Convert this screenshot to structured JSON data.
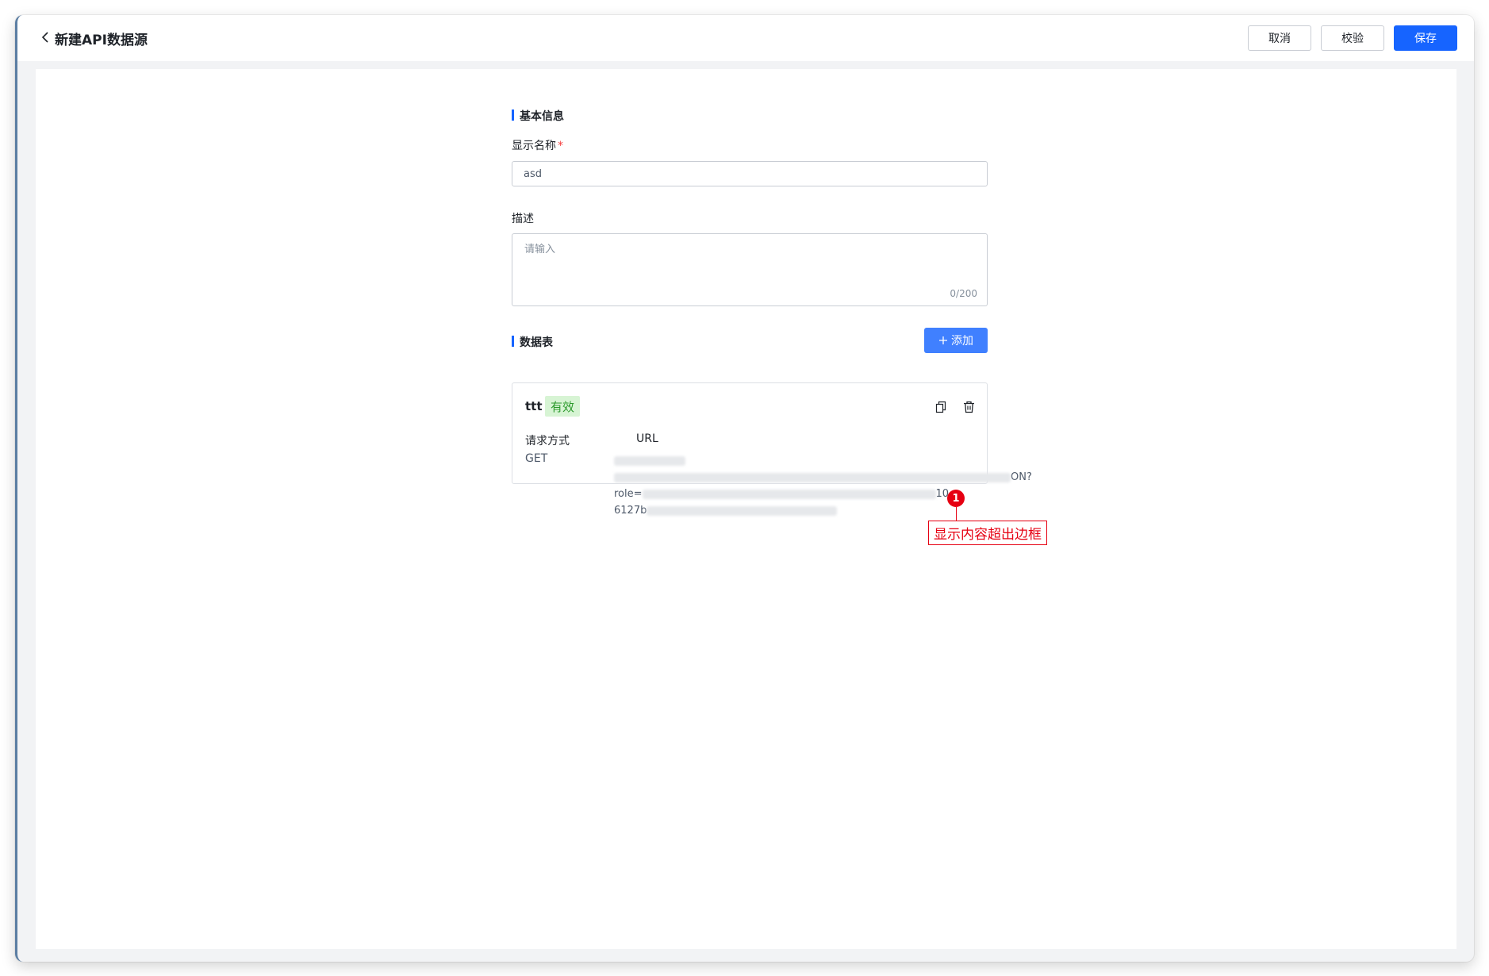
{
  "header": {
    "title": "新建API数据源",
    "cancel_label": "取消",
    "validate_label": "校验",
    "save_label": "保存"
  },
  "basic_info": {
    "section_title": "基本信息",
    "name_label": "显示名称",
    "required_mark": "*",
    "name_value": "asd",
    "desc_label": "描述",
    "desc_placeholder": "请输入",
    "desc_counter": "0/200"
  },
  "data_tables": {
    "section_title": "数据表",
    "add_label": "添加",
    "items": [
      {
        "name": "ttt",
        "status": "有效",
        "method_label": "请求方式",
        "method_value": "GET",
        "url_label": "URL",
        "url_line1_suffix": "ON?",
        "url_line2_prefix": "role=",
        "url_line2_suffix": "10-",
        "url_line3_prefix": "6127b"
      }
    ]
  },
  "annotation": {
    "number": "1",
    "text": "显示内容超出边框"
  },
  "colors": {
    "primary": "#1664ff",
    "add_button": "#4080ff",
    "valid_tag_bg": "#d7f4d4",
    "valid_tag_text": "#2c9a2c",
    "annotation": "#e60012"
  },
  "icons": {
    "back": "chevron-left-icon",
    "add": "plus-icon",
    "copy": "copy-icon",
    "delete": "trash-icon"
  }
}
